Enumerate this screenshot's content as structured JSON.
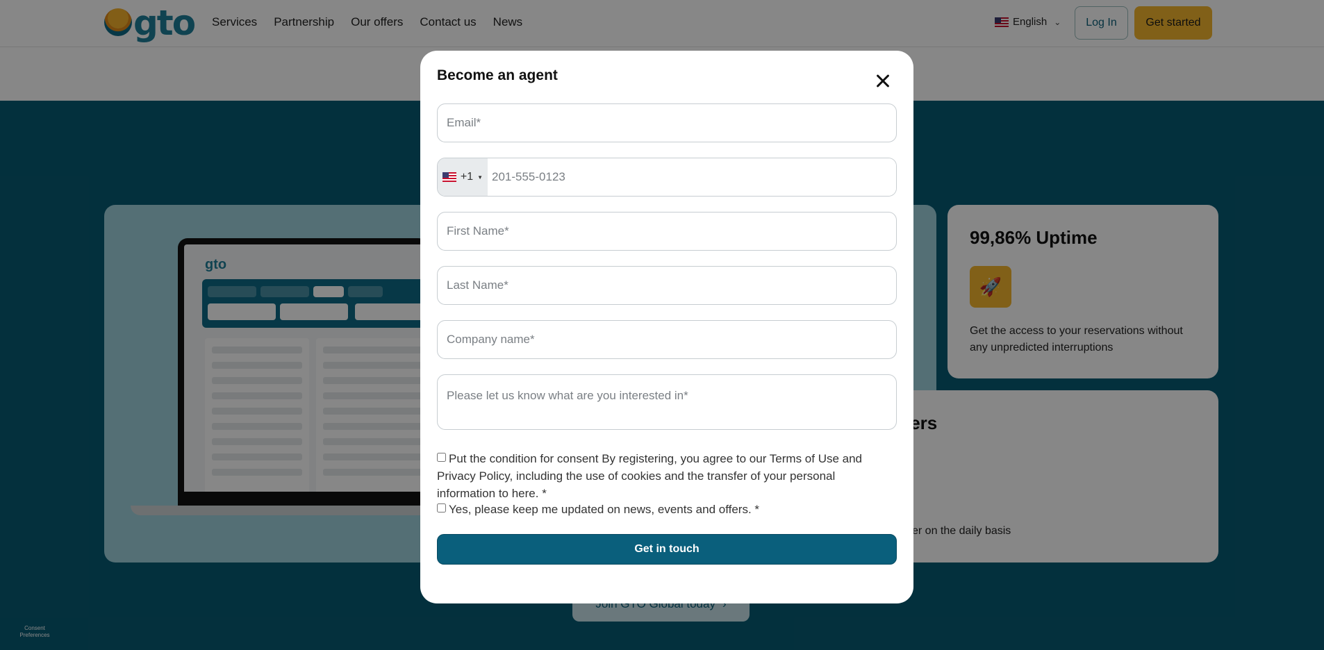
{
  "header": {
    "logo_text": "gto",
    "nav": [
      "Services",
      "Partnership",
      "Our offers",
      "Contact us",
      "News"
    ],
    "language": "English",
    "login_label": "Log In",
    "get_started_label": "Get started"
  },
  "background": {
    "uptime_title": "99,86% Uptime",
    "uptime_text": "Get the access to your reservations without any unpredicted interruptions",
    "suppliers_title_fragment": "ppliers",
    "suppliers_text_fragment": "er on the daily basis",
    "join_label": "Join GTO Global today",
    "consent_label": "Consent Preferences",
    "mini_logo": "gto"
  },
  "modal": {
    "title": "Become an agent",
    "email_placeholder": "Email*",
    "phone_code": "+1",
    "phone_placeholder": "201-555-0123",
    "first_name_placeholder": "First Name*",
    "last_name_placeholder": "Last Name*",
    "company_placeholder": "Company name*",
    "interest_placeholder": "Please let us know what are you interested in*",
    "consent_text": "Put the condition for consent By registering, you agree to our Terms of Use and Privacy Policy, including the use of cookies and the transfer of your personal information to here. *",
    "updates_text": "Yes, please keep me updated on news, events and offers. *",
    "submit_label": "Get in touch"
  },
  "colors": {
    "brand_teal": "#075b74",
    "accent_yellow": "#f3b62e",
    "button_teal": "#0a5f7c"
  }
}
